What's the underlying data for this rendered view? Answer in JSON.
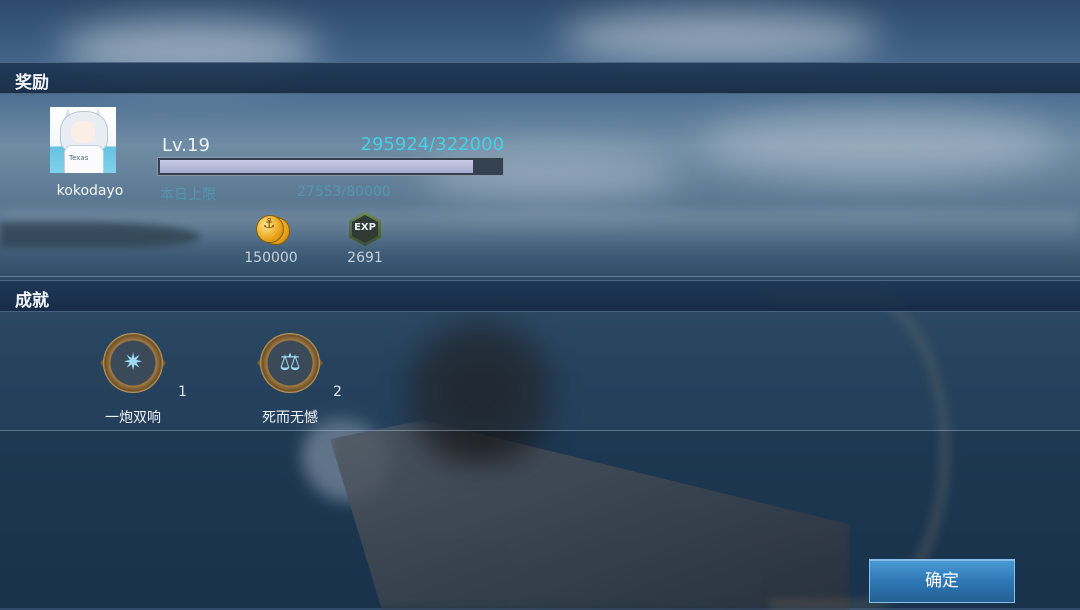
{
  "rewards": {
    "title": "奖励",
    "player": {
      "name": "kokodayo",
      "avatar_shirt_text": "Texas"
    },
    "level_label": "Lv.19",
    "xp": {
      "current": 295924,
      "max": 322000,
      "display": "295924/322000",
      "progress": 0.919
    },
    "daily_limit": {
      "label": "本日上限",
      "value": "27553/80000"
    },
    "items": [
      {
        "icon": "gold-coin-icon",
        "value": "150000"
      },
      {
        "icon": "exp-icon",
        "icon_label": "EXP",
        "value": "2691"
      }
    ]
  },
  "achievements": {
    "title": "成就",
    "items": [
      {
        "icon": "double-shot-medal-icon",
        "name": "一炮双响",
        "count": "1"
      },
      {
        "icon": "scales-medal-icon",
        "name": "死而无憾",
        "count": "2"
      }
    ]
  },
  "confirm_label": "确定",
  "colors": {
    "xp_text": "#45d0e8",
    "button": "#2f78b5",
    "section_bar": "#1e3755"
  }
}
